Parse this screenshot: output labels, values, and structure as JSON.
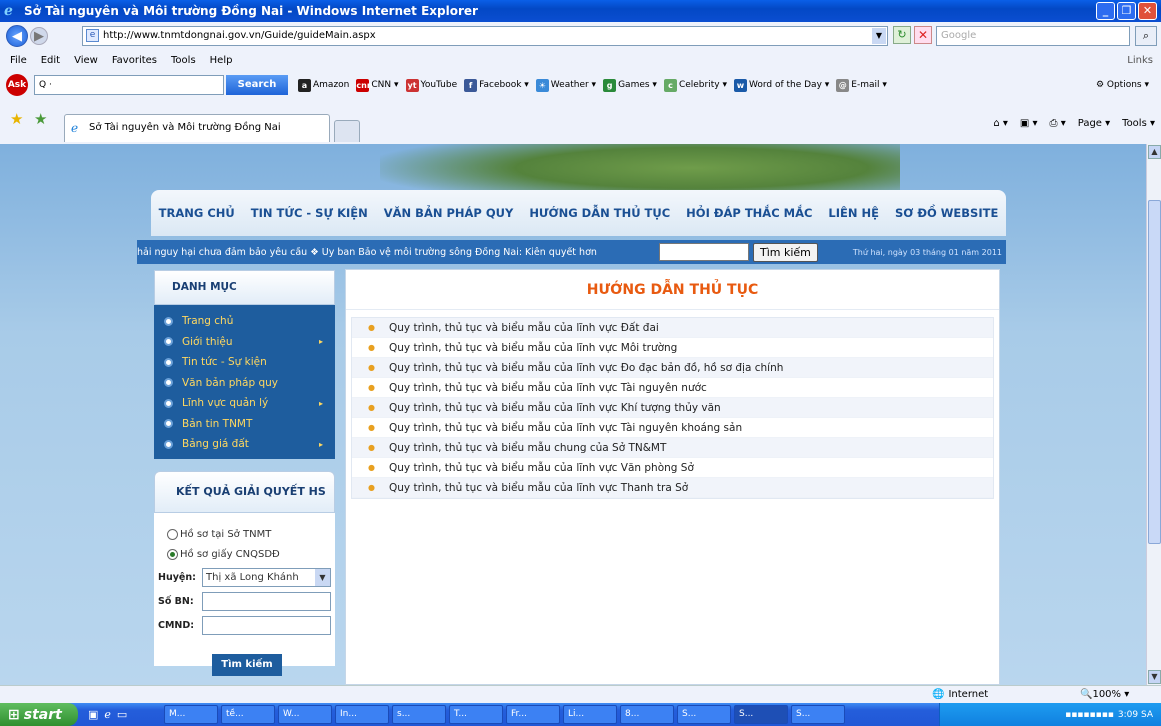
{
  "window": {
    "title": "Sở Tài nguyên và Môi trường Đồng Nai - Windows Internet Explorer"
  },
  "address": {
    "url": "http://www.tnmtdongnai.gov.vn/Guide/guideMain.aspx",
    "search_placeholder": "Google"
  },
  "menu": {
    "items": [
      "File",
      "Edit",
      "View",
      "Favorites",
      "Tools",
      "Help"
    ],
    "links": "Links"
  },
  "ask": {
    "search_label": "Search",
    "search_value": "Q ·",
    "options": "Options",
    "toolbar": [
      {
        "label": "Amazon",
        "icon": "a",
        "color": "#222"
      },
      {
        "label": "CNN ▾",
        "icon": "cnn",
        "color": "#c00"
      },
      {
        "label": "YouTube",
        "icon": "yt",
        "color": "#c33"
      },
      {
        "label": "Facebook ▾",
        "icon": "f",
        "color": "#3b5998"
      },
      {
        "label": "Weather ▾",
        "icon": "☀",
        "color": "#3a8ad8"
      },
      {
        "label": "Games ▾",
        "icon": "g",
        "color": "#2a8a3a"
      },
      {
        "label": "Celebrity ▾",
        "icon": "c",
        "color": "#6a6"
      },
      {
        "label": "Word of the Day ▾",
        "icon": "w",
        "color": "#1a5aa8"
      },
      {
        "label": "E-mail ▾",
        "icon": "@",
        "color": "#888"
      }
    ]
  },
  "tabs": {
    "active": "Sở Tài nguyên và Môi trường Đồng Nai",
    "page_label": "Page ▾",
    "tools_label": "Tools ▾"
  },
  "site": {
    "nav": [
      "TRANG CHỦ",
      "TIN TỨC - SỰ KIỆN",
      "VĂN BẢN PHÁP QUY",
      "HƯỚNG DẪN THỦ TỤC",
      "HỎI ĐÁP THẮC MẮC",
      "LIÊN HỆ",
      "SƠ ĐỒ WEBSITE"
    ],
    "ticker": "hải nguy hại chưa đảm bảo yêu cầu ❖ Ủy ban Bảo vệ môi trường sông Đồng Nai: Kiên quyết hơn",
    "search_button": "Tìm kiếm",
    "date": "Thứ hai, ngày 03 tháng 01 năm 2011"
  },
  "sidebar": {
    "heading": "DANH MỤC",
    "items": [
      {
        "label": "Trang chủ",
        "arrow": ""
      },
      {
        "label": "Giới thiệu",
        "arrow": "▸"
      },
      {
        "label": "Tin tức - Sự kiện",
        "arrow": ""
      },
      {
        "label": "Văn bản pháp quy",
        "arrow": ""
      },
      {
        "label": "Lĩnh vực quản lý",
        "arrow": "▸"
      },
      {
        "label": "Bản tin TNMT",
        "arrow": ""
      },
      {
        "label": "Bảng giá đất",
        "arrow": "▸"
      }
    ],
    "results_heading": "KẾT QUẢ GIẢI QUYẾT HS",
    "radio1": "Hồ sơ tại Sở TNMT",
    "radio2": "Hồ sơ giấy CNQSDĐ",
    "district_label": "Huyện:",
    "district_value": "Thị xã Long Khánh",
    "sobn_label": "Số BN:",
    "cmnd_label": "CMND:",
    "submit": "Tìm kiếm"
  },
  "main": {
    "title": "HƯỚNG DẪN THỦ TỤC",
    "items": [
      "Quy trình, thủ tục và biểu mẫu của lĩnh vực Đất đai",
      "Quy trình, thủ tục và biểu mẫu của lĩnh vực Môi trường",
      "Quy trình, thủ tục và biểu mẫu của lĩnh vực Đo đạc bản đồ, hồ sơ địa chính",
      "Quy trình, thủ tục và biểu mẫu của lĩnh vực Tài nguyên nước",
      "Quy trình, thủ tục và biểu mẫu của lĩnh vực Khí tượng thủy văn",
      "Quy trình, thủ tục và biểu mẫu của lĩnh vực Tài nguyên khoáng sản",
      "Quy trình, thủ tục và biểu mẫu chung của Sở TN&MT",
      "Quy trình, thủ tục và biểu mẫu của lĩnh vực Văn phòng Sở",
      "Quy trình, thủ tục và biểu mẫu của lĩnh vực Thanh tra Sở"
    ]
  },
  "status": {
    "zone": "Internet",
    "zoom": "100%"
  },
  "taskbar": {
    "start": "start",
    "tasks": [
      "M...",
      "tề...",
      "W...",
      "In...",
      "s...",
      "T...",
      "Fr...",
      "Li...",
      "8...",
      "S...",
      "S...",
      "S..."
    ],
    "clock": "3:09 SA"
  }
}
